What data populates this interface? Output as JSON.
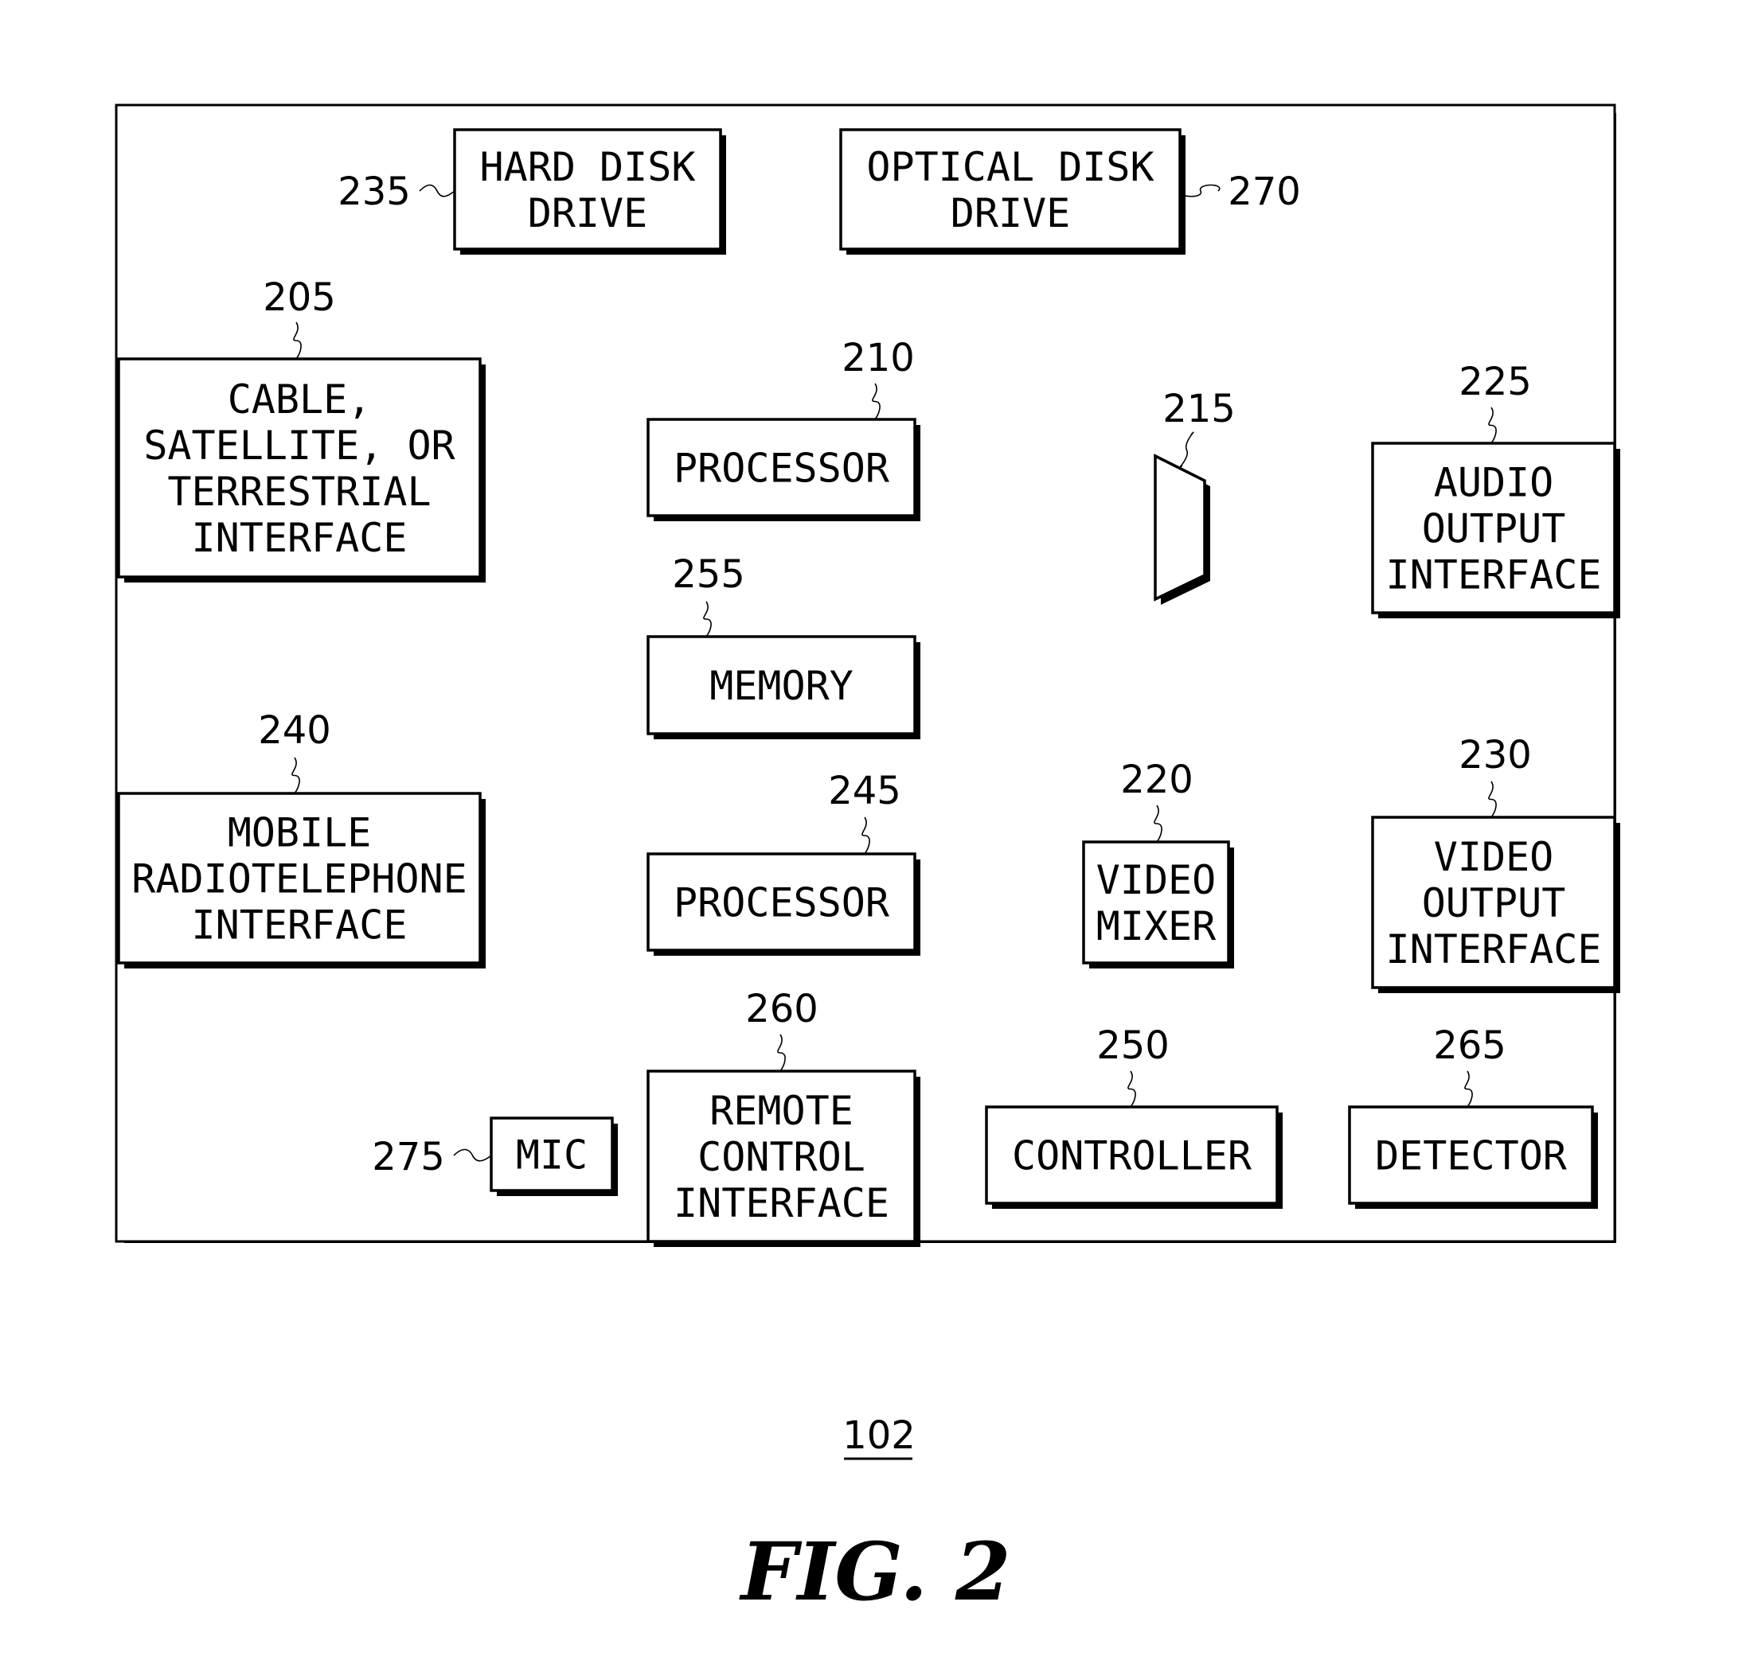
{
  "diagram": {
    "figure_label": "FIG. 2",
    "system_ref": "102",
    "colors": {
      "line": "#000000",
      "background": "#ffffff"
    },
    "blocks": [
      {
        "id": "hdd",
        "ref": "235",
        "lines": [
          "HARD DISK",
          "DRIVE"
        ]
      },
      {
        "id": "odd",
        "ref": "270",
        "lines": [
          "OPTICAL DISK",
          "DRIVE"
        ]
      },
      {
        "id": "cable",
        "ref": "205",
        "lines": [
          "CABLE,",
          "SATELLITE, OR",
          "TERRESTRIAL",
          "INTERFACE"
        ]
      },
      {
        "id": "proc210",
        "ref": "210",
        "lines": [
          "PROCESSOR"
        ]
      },
      {
        "id": "mux",
        "ref": "215",
        "lines": []
      },
      {
        "id": "audio",
        "ref": "225",
        "lines": [
          "AUDIO",
          "OUTPUT",
          "INTERFACE"
        ]
      },
      {
        "id": "memory",
        "ref": "255",
        "lines": [
          "MEMORY"
        ]
      },
      {
        "id": "mobile",
        "ref": "240",
        "lines": [
          "MOBILE",
          "RADIOTELEPHONE",
          "INTERFACE"
        ]
      },
      {
        "id": "proc245",
        "ref": "245",
        "lines": [
          "PROCESSOR"
        ]
      },
      {
        "id": "mixer",
        "ref": "220",
        "lines": [
          "VIDEO",
          "MIXER"
        ]
      },
      {
        "id": "video",
        "ref": "230",
        "lines": [
          "VIDEO",
          "OUTPUT",
          "INTERFACE"
        ]
      },
      {
        "id": "remote",
        "ref": "260",
        "lines": [
          "REMOTE",
          "CONTROL",
          "INTERFACE"
        ]
      },
      {
        "id": "controller",
        "ref": "250",
        "lines": [
          "CONTROLLER"
        ]
      },
      {
        "id": "detector",
        "ref": "265",
        "lines": [
          "DETECTOR"
        ]
      },
      {
        "id": "mic",
        "ref": "275",
        "lines": [
          "MIC"
        ]
      }
    ],
    "connections": [
      [
        "hdd",
        "proc210"
      ],
      [
        "odd",
        "proc210"
      ],
      [
        "cable",
        "proc210"
      ],
      [
        "proc210",
        "mux"
      ],
      [
        "proc210",
        "mixer"
      ],
      [
        "proc210",
        "memory"
      ],
      [
        "memory",
        "proc245"
      ],
      [
        "mobile",
        "proc245"
      ],
      [
        "mic",
        "proc245"
      ],
      [
        "proc245",
        "mux"
      ],
      [
        "proc245",
        "mixer"
      ],
      [
        "mux",
        "audio"
      ],
      [
        "mixer",
        "video"
      ],
      [
        "remote",
        "controller"
      ],
      [
        "controller",
        "detector"
      ]
    ]
  }
}
